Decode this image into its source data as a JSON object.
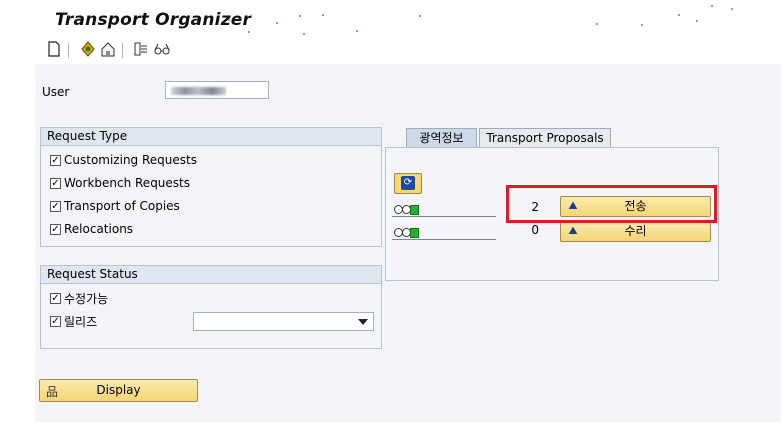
{
  "window": {
    "title": "Transport Organizer"
  },
  "toolbar": {
    "icons": [
      "new-document-icon",
      "diamond-action-icon",
      "home-building-icon",
      "transport-icon",
      "glasses-icon"
    ]
  },
  "user": {
    "label": "User",
    "value": ""
  },
  "request_type": {
    "title": "Request Type",
    "items": [
      {
        "label": "Customizing Requests",
        "checked": true
      },
      {
        "label": "Workbench Requests",
        "checked": true
      },
      {
        "label": "Transport of Copies",
        "checked": true
      },
      {
        "label": "Relocations",
        "checked": true
      }
    ]
  },
  "request_status": {
    "title": "Request Status",
    "items": [
      {
        "label": "수정가능",
        "checked": true
      },
      {
        "label": "릴리즈",
        "checked": true
      }
    ],
    "dropdown_value": ""
  },
  "tabs": [
    {
      "label": "광역정보",
      "active": true
    },
    {
      "label": "Transport Proposals",
      "active": false
    }
  ],
  "info_rows": [
    {
      "count": "2",
      "button_label": "전송"
    },
    {
      "count": "0",
      "button_label": "수리"
    }
  ],
  "display_button": {
    "label": "Display"
  },
  "colors": {
    "highlight": "#e11b1b",
    "button_bg": "#f5d675",
    "panel_bg": "#f2f4f7"
  }
}
